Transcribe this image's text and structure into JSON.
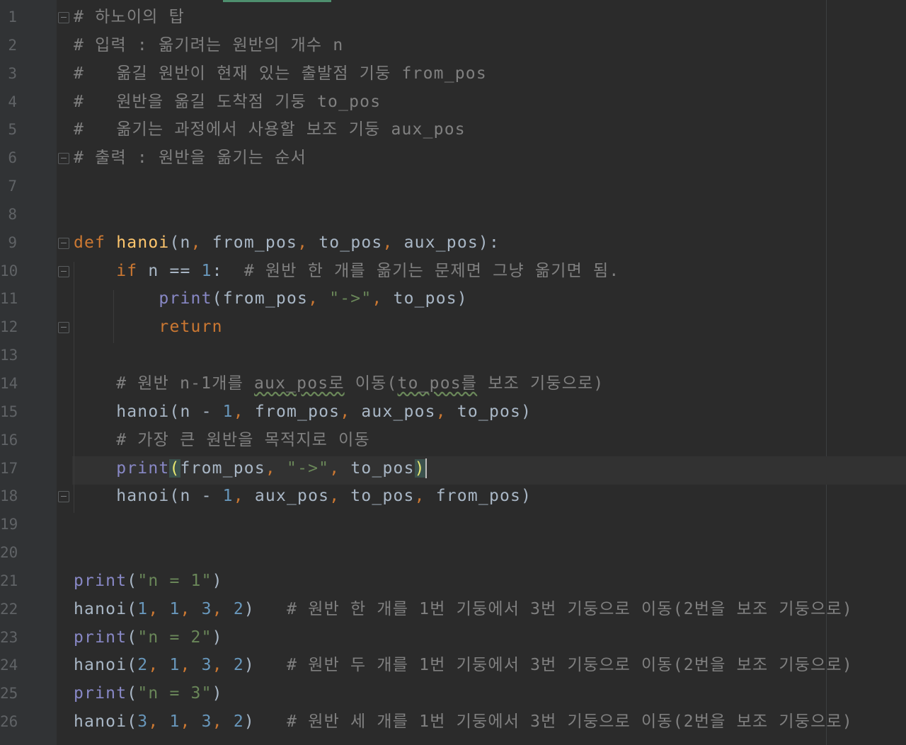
{
  "editor": {
    "language": "python",
    "current_line": 17,
    "lines": [
      {
        "n": "1",
        "tokens": [
          {
            "t": "# 하노이의 탑",
            "c": "comment"
          }
        ]
      },
      {
        "n": "2",
        "tokens": [
          {
            "t": "# 입력 : 옮기려는 원반의 개수 n",
            "c": "comment"
          }
        ]
      },
      {
        "n": "3",
        "tokens": [
          {
            "t": "#   옮길 원반이 현재 있는 출발점 기둥 from_pos",
            "c": "comment"
          }
        ]
      },
      {
        "n": "4",
        "tokens": [
          {
            "t": "#   원반을 옮길 도착점 기둥 to_pos",
            "c": "comment"
          }
        ]
      },
      {
        "n": "5",
        "tokens": [
          {
            "t": "#   옮기는 과정에서 사용할 보조 기둥 aux_pos",
            "c": "comment"
          }
        ]
      },
      {
        "n": "6",
        "tokens": [
          {
            "t": "# 출력 : 원반을 옮기는 순서",
            "c": "comment"
          }
        ]
      },
      {
        "n": "7",
        "tokens": []
      },
      {
        "n": "8",
        "tokens": []
      },
      {
        "n": "9",
        "tokens": [
          {
            "t": "def",
            "c": "kw"
          },
          {
            "t": " ",
            "c": ""
          },
          {
            "t": "hanoi",
            "c": "fn"
          },
          {
            "t": "(n",
            "c": ""
          },
          {
            "t": ",",
            "c": "punct"
          },
          {
            "t": " from_pos",
            "c": ""
          },
          {
            "t": ",",
            "c": "punct"
          },
          {
            "t": " to_pos",
            "c": ""
          },
          {
            "t": ",",
            "c": "punct"
          },
          {
            "t": " aux_pos):",
            "c": ""
          }
        ]
      },
      {
        "n": "10",
        "tokens": [
          {
            "t": "    ",
            "c": ""
          },
          {
            "t": "if",
            "c": "kw"
          },
          {
            "t": " n == ",
            "c": ""
          },
          {
            "t": "1",
            "c": "num"
          },
          {
            "t": ":  ",
            "c": ""
          },
          {
            "t": "# 원반 한 개를 옮기는 문제면 그냥 옮기면 됨.",
            "c": "comment"
          }
        ]
      },
      {
        "n": "11",
        "tokens": [
          {
            "t": "        ",
            "c": ""
          },
          {
            "t": "print",
            "c": "builtin"
          },
          {
            "t": "(from_pos",
            "c": ""
          },
          {
            "t": ",",
            "c": "punct"
          },
          {
            "t": " ",
            "c": ""
          },
          {
            "t": "\"->\"",
            "c": "str"
          },
          {
            "t": ",",
            "c": "punct"
          },
          {
            "t": " to_pos)",
            "c": ""
          }
        ]
      },
      {
        "n": "12",
        "tokens": [
          {
            "t": "        ",
            "c": ""
          },
          {
            "t": "return",
            "c": "kw"
          }
        ]
      },
      {
        "n": "13",
        "tokens": []
      },
      {
        "n": "14",
        "tokens": [
          {
            "t": "    ",
            "c": ""
          },
          {
            "t": "# 원반 n-1개를 ",
            "c": "comment"
          },
          {
            "t": "aux_pos로",
            "c": "comment squiggle"
          },
          {
            "t": " 이동(",
            "c": "comment"
          },
          {
            "t": "to_pos를",
            "c": "comment squiggle"
          },
          {
            "t": " 보조 기둥으로)",
            "c": "comment"
          }
        ]
      },
      {
        "n": "15",
        "tokens": [
          {
            "t": "    hanoi(n - ",
            "c": ""
          },
          {
            "t": "1",
            "c": "num"
          },
          {
            "t": ",",
            "c": "punct"
          },
          {
            "t": " from_pos",
            "c": ""
          },
          {
            "t": ",",
            "c": "punct"
          },
          {
            "t": " aux_pos",
            "c": ""
          },
          {
            "t": ",",
            "c": "punct"
          },
          {
            "t": " to_pos)",
            "c": ""
          }
        ]
      },
      {
        "n": "16",
        "tokens": [
          {
            "t": "    ",
            "c": ""
          },
          {
            "t": "# 가장 큰 원반을 목적지로 이동",
            "c": "comment"
          }
        ]
      },
      {
        "n": "17",
        "tokens": [
          {
            "t": "    ",
            "c": ""
          },
          {
            "t": "print",
            "c": "builtin"
          },
          {
            "t": "(",
            "c": "paren-hl"
          },
          {
            "t": "from_pos",
            "c": ""
          },
          {
            "t": ",",
            "c": "punct"
          },
          {
            "t": " ",
            "c": ""
          },
          {
            "t": "\"->\"",
            "c": "str"
          },
          {
            "t": ",",
            "c": "punct"
          },
          {
            "t": " to_pos",
            "c": ""
          },
          {
            "t": ")",
            "c": "paren-hl"
          },
          {
            "t": "",
            "c": "caret"
          }
        ]
      },
      {
        "n": "18",
        "tokens": [
          {
            "t": "    hanoi(n - ",
            "c": ""
          },
          {
            "t": "1",
            "c": "num"
          },
          {
            "t": ",",
            "c": "punct"
          },
          {
            "t": " aux_pos",
            "c": ""
          },
          {
            "t": ",",
            "c": "punct"
          },
          {
            "t": " to_pos",
            "c": ""
          },
          {
            "t": ",",
            "c": "punct"
          },
          {
            "t": " from_pos)",
            "c": ""
          }
        ]
      },
      {
        "n": "19",
        "tokens": []
      },
      {
        "n": "20",
        "tokens": []
      },
      {
        "n": "21",
        "tokens": [
          {
            "t": "print",
            "c": "builtin"
          },
          {
            "t": "(",
            "c": ""
          },
          {
            "t": "\"n = 1\"",
            "c": "str"
          },
          {
            "t": ")",
            "c": ""
          }
        ]
      },
      {
        "n": "22",
        "tokens": [
          {
            "t": "hanoi(",
            "c": ""
          },
          {
            "t": "1",
            "c": "num"
          },
          {
            "t": ",",
            "c": "punct"
          },
          {
            "t": " ",
            "c": ""
          },
          {
            "t": "1",
            "c": "num"
          },
          {
            "t": ",",
            "c": "punct"
          },
          {
            "t": " ",
            "c": ""
          },
          {
            "t": "3",
            "c": "num"
          },
          {
            "t": ",",
            "c": "punct"
          },
          {
            "t": " ",
            "c": ""
          },
          {
            "t": "2",
            "c": "num"
          },
          {
            "t": ")   ",
            "c": ""
          },
          {
            "t": "# 원반 한 개를 1번 기둥에서 3번 기둥으로 이동(2번을 보조 기둥으로)",
            "c": "comment"
          }
        ]
      },
      {
        "n": "23",
        "tokens": [
          {
            "t": "print",
            "c": "builtin"
          },
          {
            "t": "(",
            "c": ""
          },
          {
            "t": "\"n = 2\"",
            "c": "str"
          },
          {
            "t": ")",
            "c": ""
          }
        ]
      },
      {
        "n": "24",
        "tokens": [
          {
            "t": "hanoi(",
            "c": ""
          },
          {
            "t": "2",
            "c": "num"
          },
          {
            "t": ",",
            "c": "punct"
          },
          {
            "t": " ",
            "c": ""
          },
          {
            "t": "1",
            "c": "num"
          },
          {
            "t": ",",
            "c": "punct"
          },
          {
            "t": " ",
            "c": ""
          },
          {
            "t": "3",
            "c": "num"
          },
          {
            "t": ",",
            "c": "punct"
          },
          {
            "t": " ",
            "c": ""
          },
          {
            "t": "2",
            "c": "num"
          },
          {
            "t": ")   ",
            "c": ""
          },
          {
            "t": "# 원반 두 개를 1번 기둥에서 3번 기둥으로 이동(2번을 보조 기둥으로)",
            "c": "comment"
          }
        ]
      },
      {
        "n": "25",
        "tokens": [
          {
            "t": "print",
            "c": "builtin"
          },
          {
            "t": "(",
            "c": ""
          },
          {
            "t": "\"n = 3\"",
            "c": "str"
          },
          {
            "t": ")",
            "c": ""
          }
        ]
      },
      {
        "n": "26",
        "tokens": [
          {
            "t": "hanoi(",
            "c": ""
          },
          {
            "t": "3",
            "c": "num"
          },
          {
            "t": ",",
            "c": "punct"
          },
          {
            "t": " ",
            "c": ""
          },
          {
            "t": "1",
            "c": "num"
          },
          {
            "t": ",",
            "c": "punct"
          },
          {
            "t": " ",
            "c": ""
          },
          {
            "t": "3",
            "c": "num"
          },
          {
            "t": ",",
            "c": "punct"
          },
          {
            "t": " ",
            "c": ""
          },
          {
            "t": "2",
            "c": "num"
          },
          {
            "t": ")   ",
            "c": ""
          },
          {
            "t": "# 원반 세 개를 1번 기둥에서 3번 기둥으로 이동(2번을 보조 기둥으로)",
            "c": "comment"
          }
        ]
      }
    ],
    "fold_markers": [
      1,
      6,
      9,
      10,
      12,
      18
    ]
  },
  "colors": {
    "background": "#2b2b2b",
    "comment": "#808080",
    "keyword": "#cc7832",
    "function": "#ffc66d",
    "builtin": "#8888c6",
    "number": "#6897bb",
    "string": "#6a8759",
    "text": "#a9b7c6"
  }
}
